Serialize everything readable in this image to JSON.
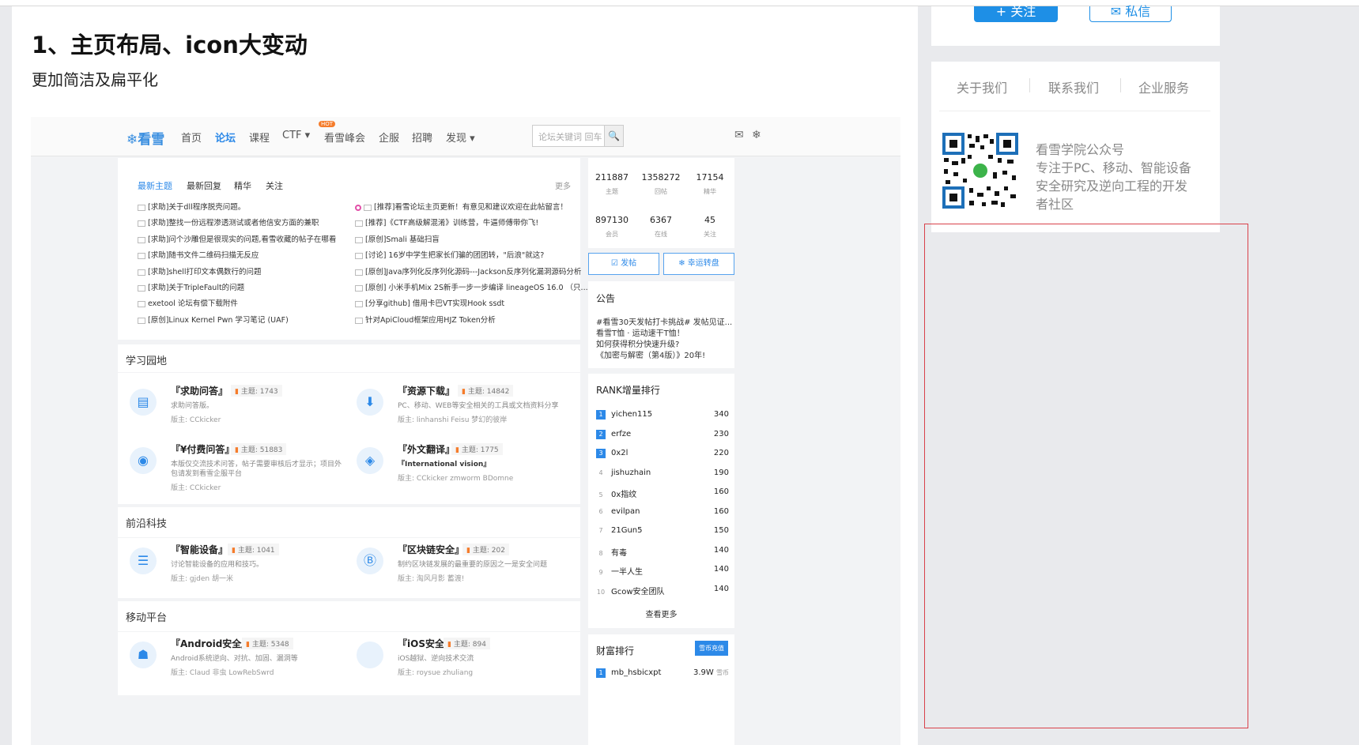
{
  "article": {
    "title": "1、主页布局、icon大变动",
    "subtitle": "更加简洁及扁平化"
  },
  "screenshot": {
    "nav": {
      "logo": "❄看雪",
      "items": [
        "首页",
        "论坛",
        "课程",
        "CTF ▾",
        "看雪峰会",
        "企服",
        "招聘",
        "发现 ▾"
      ],
      "hot_badge": "HOT",
      "search_placeholder": "论坛关键词 回车"
    },
    "tabs": [
      "最新主题",
      "最新回复",
      "精华",
      "关注"
    ],
    "more": "更多",
    "threads_left": [
      "[求助]关于dll程序脱壳问题。",
      "[求助]整找一份远程渗透测试或者他信安方面的兼职",
      "[求助]问个沙雕但是很现实的问题,看雪收藏的帖子在哪看",
      "[求助]随书文件二维码扫描无反应",
      "[求助]shell打印文本偶数行的问题",
      "[求助]关于TripleFault的问题",
      "exetool 论坛有偿下载附件",
      "[原创]Linux Kernel Pwn 学习笔记 (UAF)"
    ],
    "threads_right": [
      "[推荐]看雪论坛主页更新！有意见和建议欢迎在此帖留言！",
      "[推荐]《CTF高级解混淆》训练营，牛逼师傅带你飞!",
      "[原创]Smali 基础扫盲",
      "[讨论] 16岁中学生把家长们骗的团团转，\"后浪\"就这?",
      "[原创]Java序列化反序列化源码---Jackson反序列化漏洞源码分析",
      "[原创] 小米手机Mix 2S新手一步一步编译 lineageOS 16.0 （只...",
      "[分享github] 借用卡巴VT实现Hook ssdt",
      "针对ApiCloud框架应用HJZ Token分析"
    ],
    "sections": {
      "study": "学习园地",
      "frontier": "前沿科技",
      "mobile": "移动平台"
    },
    "topic_label": "主题:",
    "mod_label": "版主:",
    "forums": {
      "qa": {
        "name": "『求助问答』",
        "count": "1743",
        "desc": "求助问答版。",
        "mods": "CCkicker"
      },
      "download": {
        "name": "『资源下载』",
        "count": "14842",
        "desc": "PC、移动、WEB等安全相关的工具或文档资料分享",
        "mods": "linhanshi  Feisu  梦幻的彼岸"
      },
      "paid": {
        "name": "『¥付费问答』",
        "count": "51883",
        "desc": "本版仅交流技术问答，帖子需要审核后才显示；项目外",
        "desc2": "包请发到看雪企服平台",
        "mods": "CCkicker"
      },
      "translate": {
        "name": "『外文翻译』",
        "count": "1775",
        "desc": "『International vision』",
        "mods": "CCkicker  zmworm  BDomne"
      },
      "smart": {
        "name": "『智能设备』",
        "count": "1041",
        "desc": "讨论智能设备的应用和技巧。",
        "mods": "gjden  胡一米"
      },
      "blockchain": {
        "name": "『区块链安全』",
        "count": "202",
        "desc": "制约区块链发展的最重要的原因之一是安全问题",
        "mods": "淘风月影  蓄渡!"
      },
      "android": {
        "name": "『Android安全』",
        "count": "5348",
        "desc": "Android系统逆向、对抗、加固、漏洞等",
        "mods": "Claud  非虫  LowRebSwrd"
      },
      "ios": {
        "name": "『iOS安全』",
        "count": "894",
        "desc": "iOS越狱、逆向技术交流",
        "mods": "roysue  zhuliang"
      }
    },
    "stats": [
      {
        "num": "211887",
        "label": "主题"
      },
      {
        "num": "1358272",
        "label": "回帖"
      },
      {
        "num": "17154",
        "label": "精华"
      },
      {
        "num": "897130",
        "label": "会员"
      },
      {
        "num": "6367",
        "label": "在线"
      },
      {
        "num": "45",
        "label": "关注"
      }
    ],
    "post_button": "☑ 发帖",
    "lucky_button": "❄ 幸运转盘",
    "notice": {
      "title": "公告",
      "lines": [
        "#看雪30天发帖打卡挑战# 发帖见证...",
        "看雪T恤 · 运动速干T恤！",
        "如何获得积分快速升级?",
        "《加密与解密（第4版）》20年!"
      ]
    },
    "rank": {
      "title": "RANK增量排行",
      "items": [
        {
          "rank": "1",
          "name": "yichen115",
          "value": "340"
        },
        {
          "rank": "2",
          "name": "erfze",
          "value": "230"
        },
        {
          "rank": "3",
          "name": "0x2l",
          "value": "220"
        },
        {
          "rank": "4",
          "name": "jishuzhain",
          "value": "190"
        },
        {
          "rank": "5",
          "name": "0x指纹",
          "value": "160"
        },
        {
          "rank": "6",
          "name": "evilpan",
          "value": "160"
        },
        {
          "rank": "7",
          "name": "21Gun5",
          "value": "150"
        },
        {
          "rank": "8",
          "name": "有毒",
          "value": "140"
        },
        {
          "rank": "9",
          "name": "一半人生",
          "value": "140"
        },
        {
          "rank": "10",
          "name": "Gcow安全团队",
          "value": "140"
        }
      ],
      "see_more": "查看更多"
    },
    "wealth": {
      "title": "财富排行",
      "topup": "雪币充值",
      "first": {
        "rank": "1",
        "name": "mb_hsbicxpt",
        "value": "3.9W",
        "unit": "雪币"
      }
    }
  },
  "sidebar": {
    "follow_button": "+ 关注",
    "message_button": "✉ 私信",
    "links": [
      "关于我们",
      "联系我们",
      "企业服务"
    ],
    "qr_lines": [
      "看雪学院公众号",
      "专注于PC、移动、智能设备",
      "安全研究及逆向工程的开发",
      "者社区"
    ]
  }
}
